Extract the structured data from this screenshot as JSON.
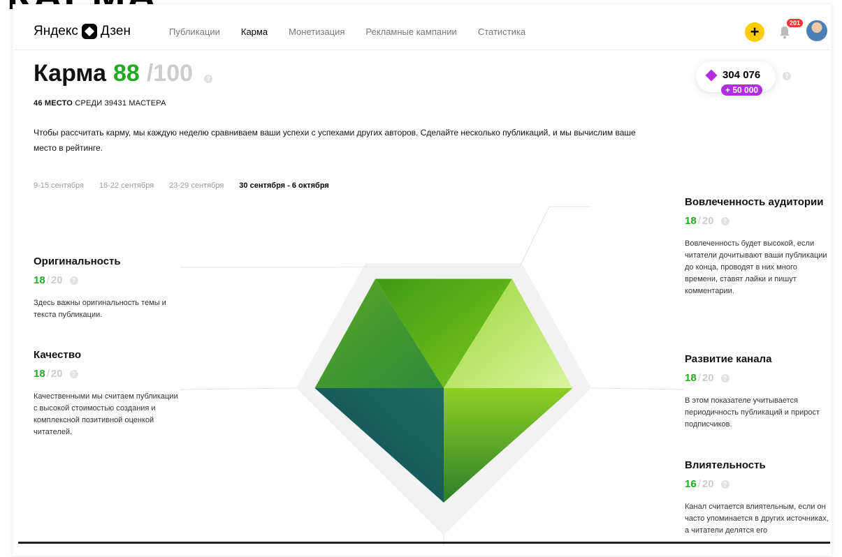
{
  "header": {
    "logo_left": "Яндекс",
    "logo_right": "Дзен",
    "nav": [
      {
        "label": "Публикации",
        "active": false
      },
      {
        "label": "Карма",
        "active": true
      },
      {
        "label": "Монетизация",
        "active": false
      },
      {
        "label": "Рекламные кампании",
        "active": false
      },
      {
        "label": "Статистика",
        "active": false
      }
    ],
    "add_label": "+",
    "notifications_count": "201"
  },
  "karma": {
    "title": "Карма",
    "score": "88",
    "max": "/100",
    "help": "?",
    "rank_place": "46 МЕСТО",
    "rank_rest": "СРЕДИ 39431 МАСТЕРА",
    "description": "Чтобы рассчитать карму, мы каждую неделю сравниваем ваши успехи с успехами других авторов. Сделайте несколько публикаций, и мы вычислим ваше место в рейтинге."
  },
  "weeks": [
    {
      "label": "9-15 сентября",
      "active": false
    },
    {
      "label": "16-22 сентября",
      "active": false
    },
    {
      "label": "23-29 сентября",
      "active": false
    },
    {
      "label": "30 сентября - 6 октября",
      "active": true
    }
  ],
  "balance": {
    "amount": "304 076",
    "bonus": "+ 50 000"
  },
  "metrics": {
    "originality": {
      "name": "Оригинальность",
      "value": "18",
      "sep": "/",
      "max": "20",
      "text": "Здесь важны оригинальность темы и текста публикации."
    },
    "quality": {
      "name": "Качество",
      "value": "18",
      "sep": "/",
      "max": "20",
      "text": "Качественными мы считаем публикации с высокой стоимостью создания и комплексной позитивной оценкой читателей."
    },
    "engagement": {
      "name": "Вовлеченность аудитории",
      "value": "18",
      "sep": "/",
      "max": "20",
      "text": "Вовлеченность будет высокой, если читатели дочитывают ваши публикации до конца, проводят в них много времени, ставят лайки и пишут комментарии."
    },
    "development": {
      "name": "Развитие канала",
      "value": "18",
      "sep": "/",
      "max": "20",
      "text": "В этом показателе учитывается периодичность публикаций и прирост подписчиков."
    },
    "influence": {
      "name": "Влиятельность",
      "value": "16",
      "sep": "/",
      "max": "20",
      "text": "Канал считается влиятельным, если он часто упоминается в других источниках, а читатели делятся его"
    }
  },
  "chart_data": {
    "type": "radar",
    "max": 20,
    "axes": [
      "Оригинальность",
      "Вовлеченность аудитории",
      "Развитие канала",
      "Влиятельность",
      "Качество"
    ],
    "values": [
      18,
      18,
      18,
      16,
      18
    ]
  },
  "colors": {
    "score_green": "#22aa22",
    "accent_yellow": "#ffcc00",
    "purple": "#b12ee0"
  }
}
